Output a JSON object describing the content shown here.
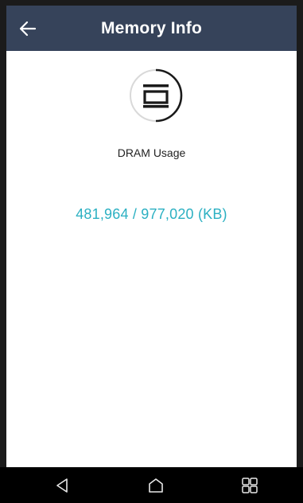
{
  "app_bar": {
    "title": "Memory Info",
    "back_icon": "arrow-left-icon"
  },
  "main": {
    "icon": "memory-chip-icon",
    "usage_label": "DRAM Usage",
    "usage_value": "481,964 / 977,020 (KB)"
  },
  "nav_bar": {
    "back_icon": "triangle-back-icon",
    "home_icon": "home-icon",
    "recents_icon": "grid-recents-icon"
  },
  "colors": {
    "app_bar": "#36435a",
    "accent": "#2bb0c2"
  }
}
